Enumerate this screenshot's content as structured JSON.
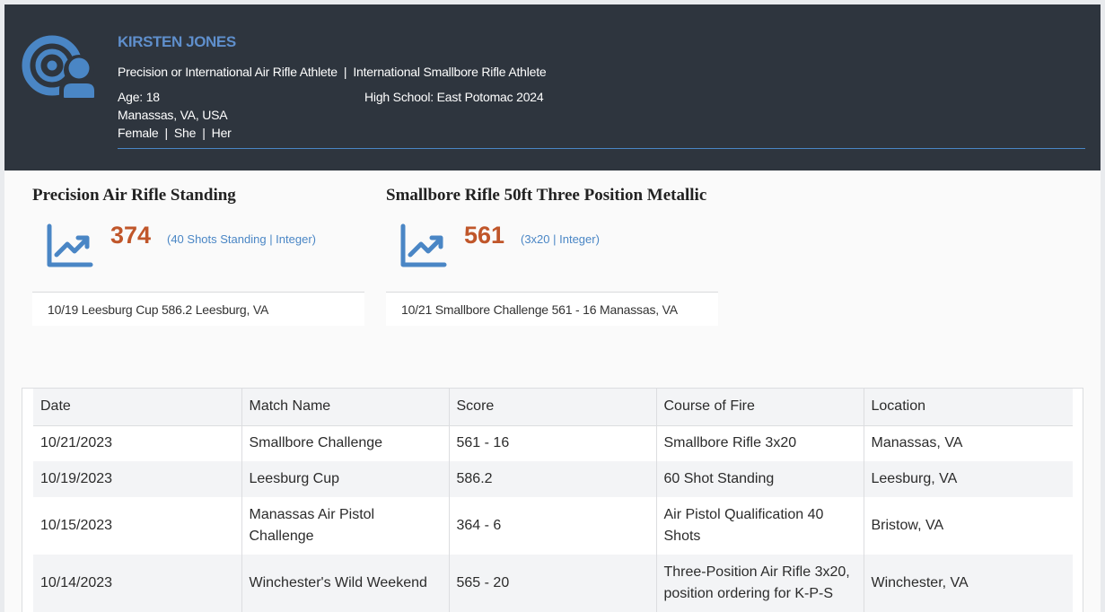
{
  "athlete": {
    "name": "KIRSTEN JONES",
    "disciplines": [
      "Precision or International Air Rifle Athlete",
      "International Smallbore Rifle Athlete"
    ],
    "age": "Age: 18",
    "location": "Manassas, VA, USA",
    "school": "High School: East Potomac 2024",
    "gender": "Female",
    "pronoun_1": "She",
    "pronoun_2": "Her",
    "divider": "|"
  },
  "cards": [
    {
      "title": "Precision Air Rifle Standing",
      "score": "374",
      "detail": "(40 Shots Standing | Integer)",
      "last_match": "10/19 Leesburg Cup 586.2 Leesburg, VA"
    },
    {
      "title": "Smallbore Rifle 50ft Three Position Metallic",
      "score": "561",
      "detail": "(3x20 | Integer)",
      "last_match": "10/21 Smallbore Challenge 561 - 16 Manassas, VA"
    }
  ],
  "table": {
    "headers": [
      "Date",
      "Match Name",
      "Score",
      "Course of Fire",
      "Location"
    ],
    "rows": [
      [
        "10/21/2023",
        "Smallbore Challenge",
        "561 - 16",
        "Smallbore Rifle 3x20",
        "Manassas, VA"
      ],
      [
        "10/19/2023",
        "Leesburg Cup",
        "586.2",
        "60 Shot Standing",
        "Leesburg, VA"
      ],
      [
        "10/15/2023",
        "Manassas Air Pistol Challenge",
        "364 - 6",
        "Air Pistol Qualification 40 Shots",
        "Bristow, VA"
      ],
      [
        "10/14/2023",
        "Winchester's Wild Weekend",
        "565 - 20",
        "Three-Position Air Rifle 3x20, position ordering for K-P-S",
        "Winchester, VA"
      ]
    ]
  },
  "icons": {
    "logo": "target-user-icon",
    "trend": "trending-up-chart-icon"
  },
  "colors": {
    "header_bg": "#2e353e",
    "accent_blue": "#4a86c5",
    "name_blue": "#5f8fcc",
    "score_orange": "#c0562a"
  }
}
